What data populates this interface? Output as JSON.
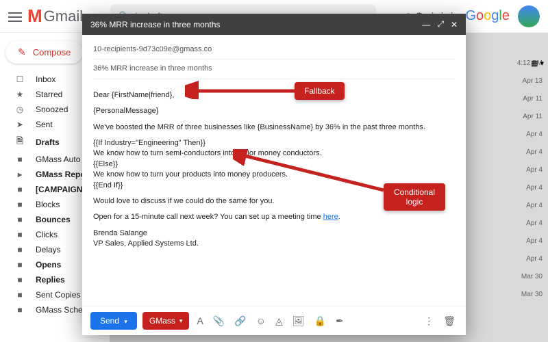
{
  "header": {
    "gmail_label": "Gmail",
    "search_text": "in:draft",
    "google_label": "Google"
  },
  "sidebar": {
    "compose_label": "Compose",
    "items": [
      {
        "icon": "☐",
        "label": "Inbox",
        "bold": false
      },
      {
        "icon": "★",
        "label": "Starred",
        "bold": false
      },
      {
        "icon": "◷",
        "label": "Snoozed",
        "bold": false
      },
      {
        "icon": "➤",
        "label": "Sent",
        "bold": false
      },
      {
        "icon": "🗎",
        "label": "Drafts",
        "bold": true
      },
      {
        "icon": "■",
        "label": "GMass Auto F",
        "bold": false
      },
      {
        "icon": "▸",
        "label": "GMass Repor",
        "bold": true
      },
      {
        "icon": "■",
        "label": "[CAMPAIGN",
        "bold": true
      },
      {
        "icon": "■",
        "label": "Blocks",
        "bold": false
      },
      {
        "icon": "■",
        "label": "Bounces",
        "bold": true
      },
      {
        "icon": "■",
        "label": "Clicks",
        "bold": false
      },
      {
        "icon": "■",
        "label": "Delays",
        "bold": false
      },
      {
        "icon": "■",
        "label": "Opens",
        "bold": true
      },
      {
        "icon": "■",
        "label": "Replies",
        "bold": true
      },
      {
        "icon": "■",
        "label": "Sent Copies",
        "bold": false
      },
      {
        "icon": "■",
        "label": "GMass Sched",
        "bold": false
      }
    ]
  },
  "mail_times": [
    "4:12 PM",
    "Apr 13",
    "Apr 11",
    "Apr 11",
    "Apr 4",
    "Apr 4",
    "Apr 4",
    "Apr 4",
    "Apr 4",
    "Apr 4",
    "Apr 4",
    "Apr 4",
    "Mar 30",
    "Mar 30"
  ],
  "compose": {
    "title": "36% MRR increase in three months",
    "to": "10-recipients-9d73c09e@gmass.co",
    "subject": "36% MRR increase in three months",
    "body": {
      "greeting": "Dear {FirstName|friend},",
      "personal": "{PersonalMessage}",
      "p1": "We've boosted the MRR of three businesses like {BusinessName} by 36% in the past three months.",
      "if_line": "{{If Industry=\"Engineering\" Then}}",
      "if_body": "We know how to turn semi-conductors into major money conductors.",
      "else_line": "{{Else}}",
      "else_body": "We know how to turn your products into money producers.",
      "endif": "{{End If}}",
      "p2": "Would love to discuss if we could do the same for you.",
      "p3_a": "Open for a 15-minute call next week? You can set up a meeting time ",
      "p3_link": "here",
      "p3_b": ".",
      "sig1": "Brenda Salange",
      "sig2": "VP Sales, Applied Systems Ltd."
    },
    "send_label": "Send",
    "gmass_label": "GMass"
  },
  "annotations": {
    "fallback": "Fallback",
    "conditional": "Conditional logic"
  }
}
